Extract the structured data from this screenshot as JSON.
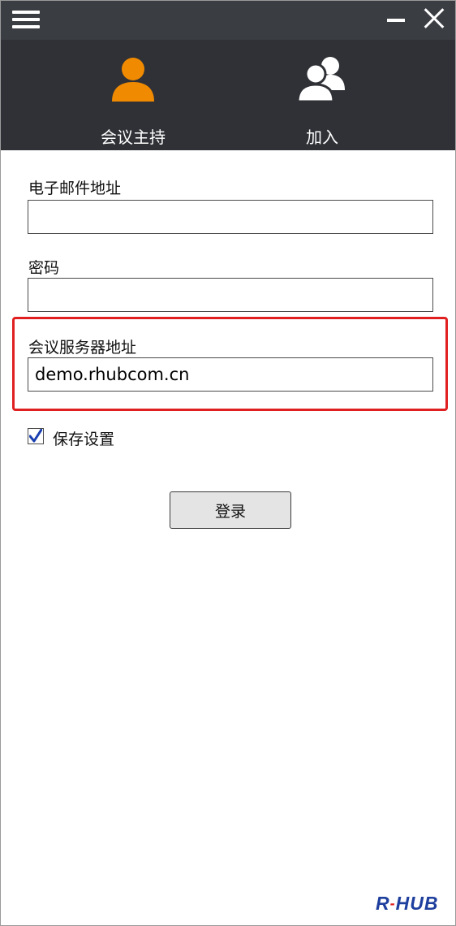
{
  "titlebar": {
    "menu_icon": "hamburger-menu-icon",
    "minimize_icon": "minimize-icon",
    "close_icon": "close-icon",
    "background": "#3a3d42"
  },
  "tabs": [
    {
      "label": "会议主持",
      "icon": "user-icon",
      "icon_color": "#f08a00",
      "active": true
    },
    {
      "label": "加入",
      "icon": "users-group-icon",
      "icon_color": "#ffffff",
      "active": false
    }
  ],
  "form": {
    "email": {
      "label": "电子邮件地址",
      "value": "",
      "placeholder": ""
    },
    "password": {
      "label": "密码",
      "value": "",
      "placeholder": ""
    },
    "server": {
      "label": "会议服务器地址",
      "value": "demo.rhubcom.cn",
      "placeholder": ""
    },
    "save_settings": {
      "label": "保存设置",
      "checked": true
    },
    "login_label": "登录"
  },
  "highlight_color": "#e02020",
  "brand": {
    "logo_text": "R-HUB",
    "color": "#1e3f9e"
  }
}
